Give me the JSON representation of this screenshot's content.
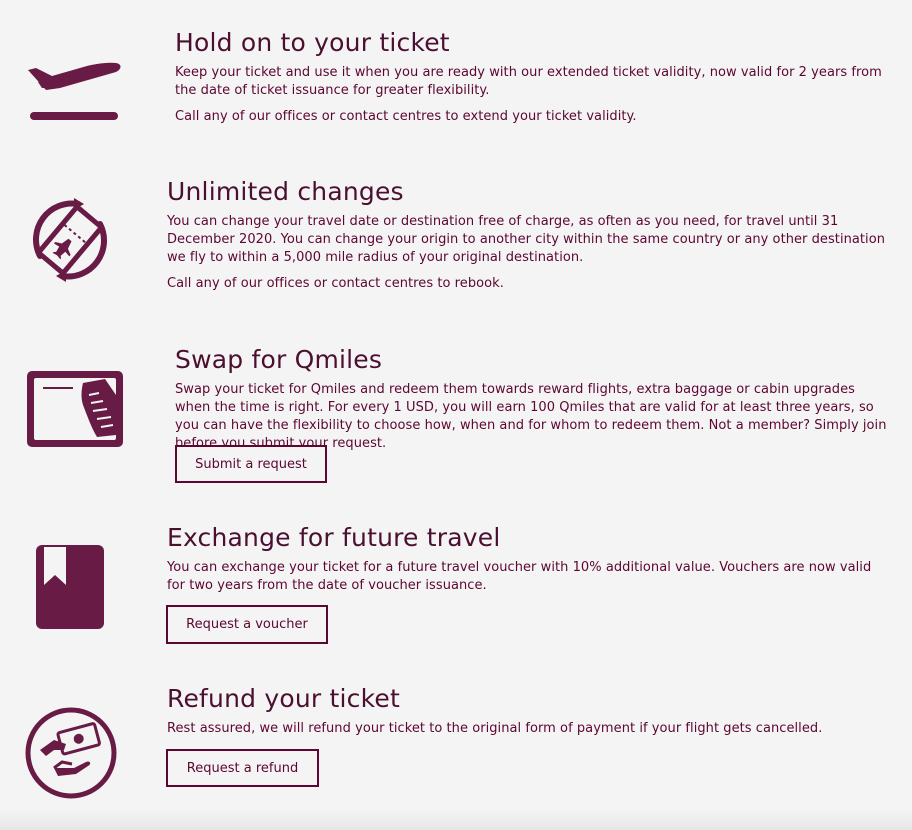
{
  "colors": {
    "background": "#f4f4f4",
    "brand": "#5c0632",
    "icon": "#681b44"
  },
  "sections": [
    {
      "icon": "airplane-takeoff-icon",
      "title": "Hold on to your ticket",
      "paragraphs": [
        "Keep your ticket and use it when you are ready with our extended ticket validity, now valid for 2 years from the date of ticket issuance for greater flexibility.",
        "Call any of our offices or contact centres to extend your ticket validity."
      ]
    },
    {
      "icon": "ticket-change-icon",
      "title": "Unlimited changes",
      "paragraphs": [
        "You can change your travel date or destination free of charge, as often as you need, for travel until 31 December 2020. You can change your origin to another city within the same country or any other destination we fly to within a 5,000 mile radius of your original destination.",
        "Call any of our offices or contact centres to rebook."
      ]
    },
    {
      "icon": "qmiles-card-icon",
      "title": "Swap for Qmiles",
      "paragraphs": [
        "Swap your ticket for Qmiles and redeem them towards reward flights, extra baggage or cabin upgrades when the time is right. For every 1 USD, you will earn 100 Qmiles that are valid for at least three years, so you can have the flexibility to choose how, when and for whom to redeem them. Not a member? Simply join before you submit your request."
      ],
      "button": "Submit a request"
    },
    {
      "icon": "voucher-book-icon",
      "title": "Exchange for future travel",
      "paragraphs": [
        "You can exchange your ticket for a future travel voucher with 10% additional value. Vouchers are now valid for two years from the date of voucher issuance."
      ],
      "button": "Request a voucher"
    },
    {
      "icon": "refund-money-icon",
      "title": "Refund your ticket",
      "paragraphs": [
        "Rest assured, we will refund your ticket to the original form of payment if your flight gets cancelled."
      ],
      "button": "Request a refund"
    }
  ]
}
